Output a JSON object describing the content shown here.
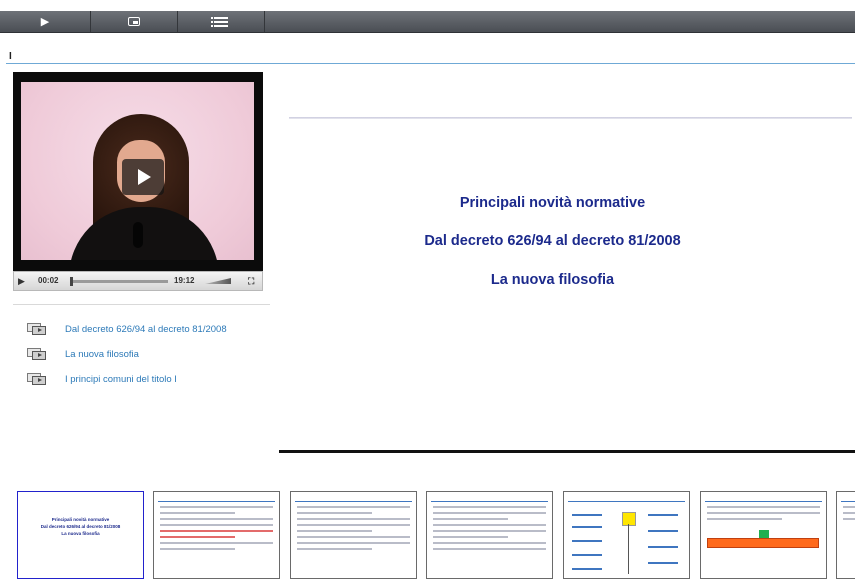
{
  "toolbar": {
    "buttons": [
      {
        "name": "play-icon",
        "glyph": "▶"
      },
      {
        "name": "picture-in-picture-icon"
      },
      {
        "name": "list-icon"
      }
    ]
  },
  "page": {
    "title": "I"
  },
  "player": {
    "current_time": "00:02",
    "duration": "19:12",
    "progress_fraction": 0.002
  },
  "chapters": [
    {
      "label": "Dal decreto 626/94 al decreto 81/2008"
    },
    {
      "label": "La nuova filosofia"
    },
    {
      "label": "I principi comuni del titolo I"
    }
  ],
  "slide": {
    "lines": [
      "Principali novità normative",
      "Dal decreto 626/94 al decreto 81/2008",
      "La nuova filosofia"
    ]
  },
  "thumbnails": {
    "first": {
      "lines": [
        "Principali novità normative",
        "Dal decreto 626/94 al decreto 81/2008",
        "La nuova filosofia"
      ]
    },
    "count": 6
  }
}
